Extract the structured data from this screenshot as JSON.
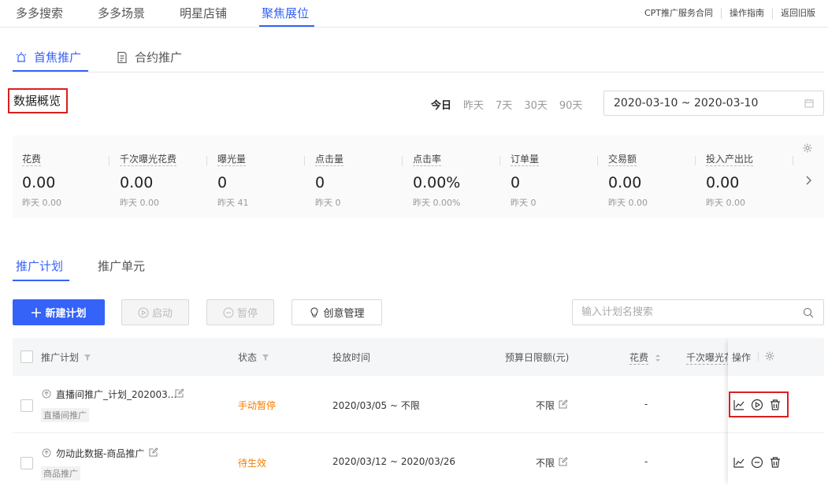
{
  "top_nav": {
    "tabs": [
      "多多搜索",
      "多多场景",
      "明星店铺",
      "聚焦展位"
    ],
    "active_tab": "聚焦展位",
    "links": [
      "CPT推广服务合同",
      "操作指南",
      "返回旧版"
    ]
  },
  "sub_nav": {
    "tabs": [
      "首焦推广",
      "合约推广"
    ],
    "active_tab": "首焦推广"
  },
  "overview": {
    "title": "数据概览",
    "ranges": [
      "今日",
      "昨天",
      "7天",
      "30天",
      "90天"
    ],
    "active_range": "今日",
    "date_range": "2020-03-10 ~ 2020-03-10",
    "metrics": [
      {
        "label": "花费",
        "value": "0.00",
        "yesterday": "昨天 0.00"
      },
      {
        "label": "千次曝光花费",
        "value": "0.00",
        "yesterday": "昨天 0.00"
      },
      {
        "label": "曝光量",
        "value": "0",
        "yesterday": "昨天 41"
      },
      {
        "label": "点击量",
        "value": "0",
        "yesterday": "昨天 0"
      },
      {
        "label": "点击率",
        "value": "0.00%",
        "yesterday": "昨天 0.00%"
      },
      {
        "label": "订单量",
        "value": "0",
        "yesterday": "昨天 0"
      },
      {
        "label": "交易额",
        "value": "0.00",
        "yesterday": "昨天 0.00"
      },
      {
        "label": "投入产出比",
        "value": "0.00",
        "yesterday": "昨天 0.00"
      }
    ]
  },
  "plan_tabs": {
    "tabs": [
      "推广计划",
      "推广单元"
    ],
    "active_tab": "推广计划"
  },
  "toolbar": {
    "new_plan": "新建计划",
    "start": "启动",
    "pause": "暂停",
    "creative": "创意管理",
    "search_placeholder": "输入计划名搜索"
  },
  "table": {
    "headers": {
      "plan": "推广计划",
      "status": "状态",
      "time": "投放时间",
      "budget": "预算日限额(元)",
      "spend": "花费",
      "cpm": "千次曝光花",
      "ops": "操作"
    },
    "rows": [
      {
        "name": "直播间推广_计划_202003...",
        "type": "直播间推广",
        "status": "手动暂停",
        "time": "2020/03/05 ~ 不限",
        "budget": "不限",
        "spend": "-"
      },
      {
        "name": "勿动此数据-商品推广",
        "type": "商品推广",
        "status": "待生效",
        "time": "2020/03/12 ~ 2020/03/26",
        "budget": "不限",
        "spend": "-"
      }
    ]
  },
  "colors": {
    "accent": "#3562f7",
    "warning": "#f57c00",
    "highlight": "#d9201f"
  }
}
